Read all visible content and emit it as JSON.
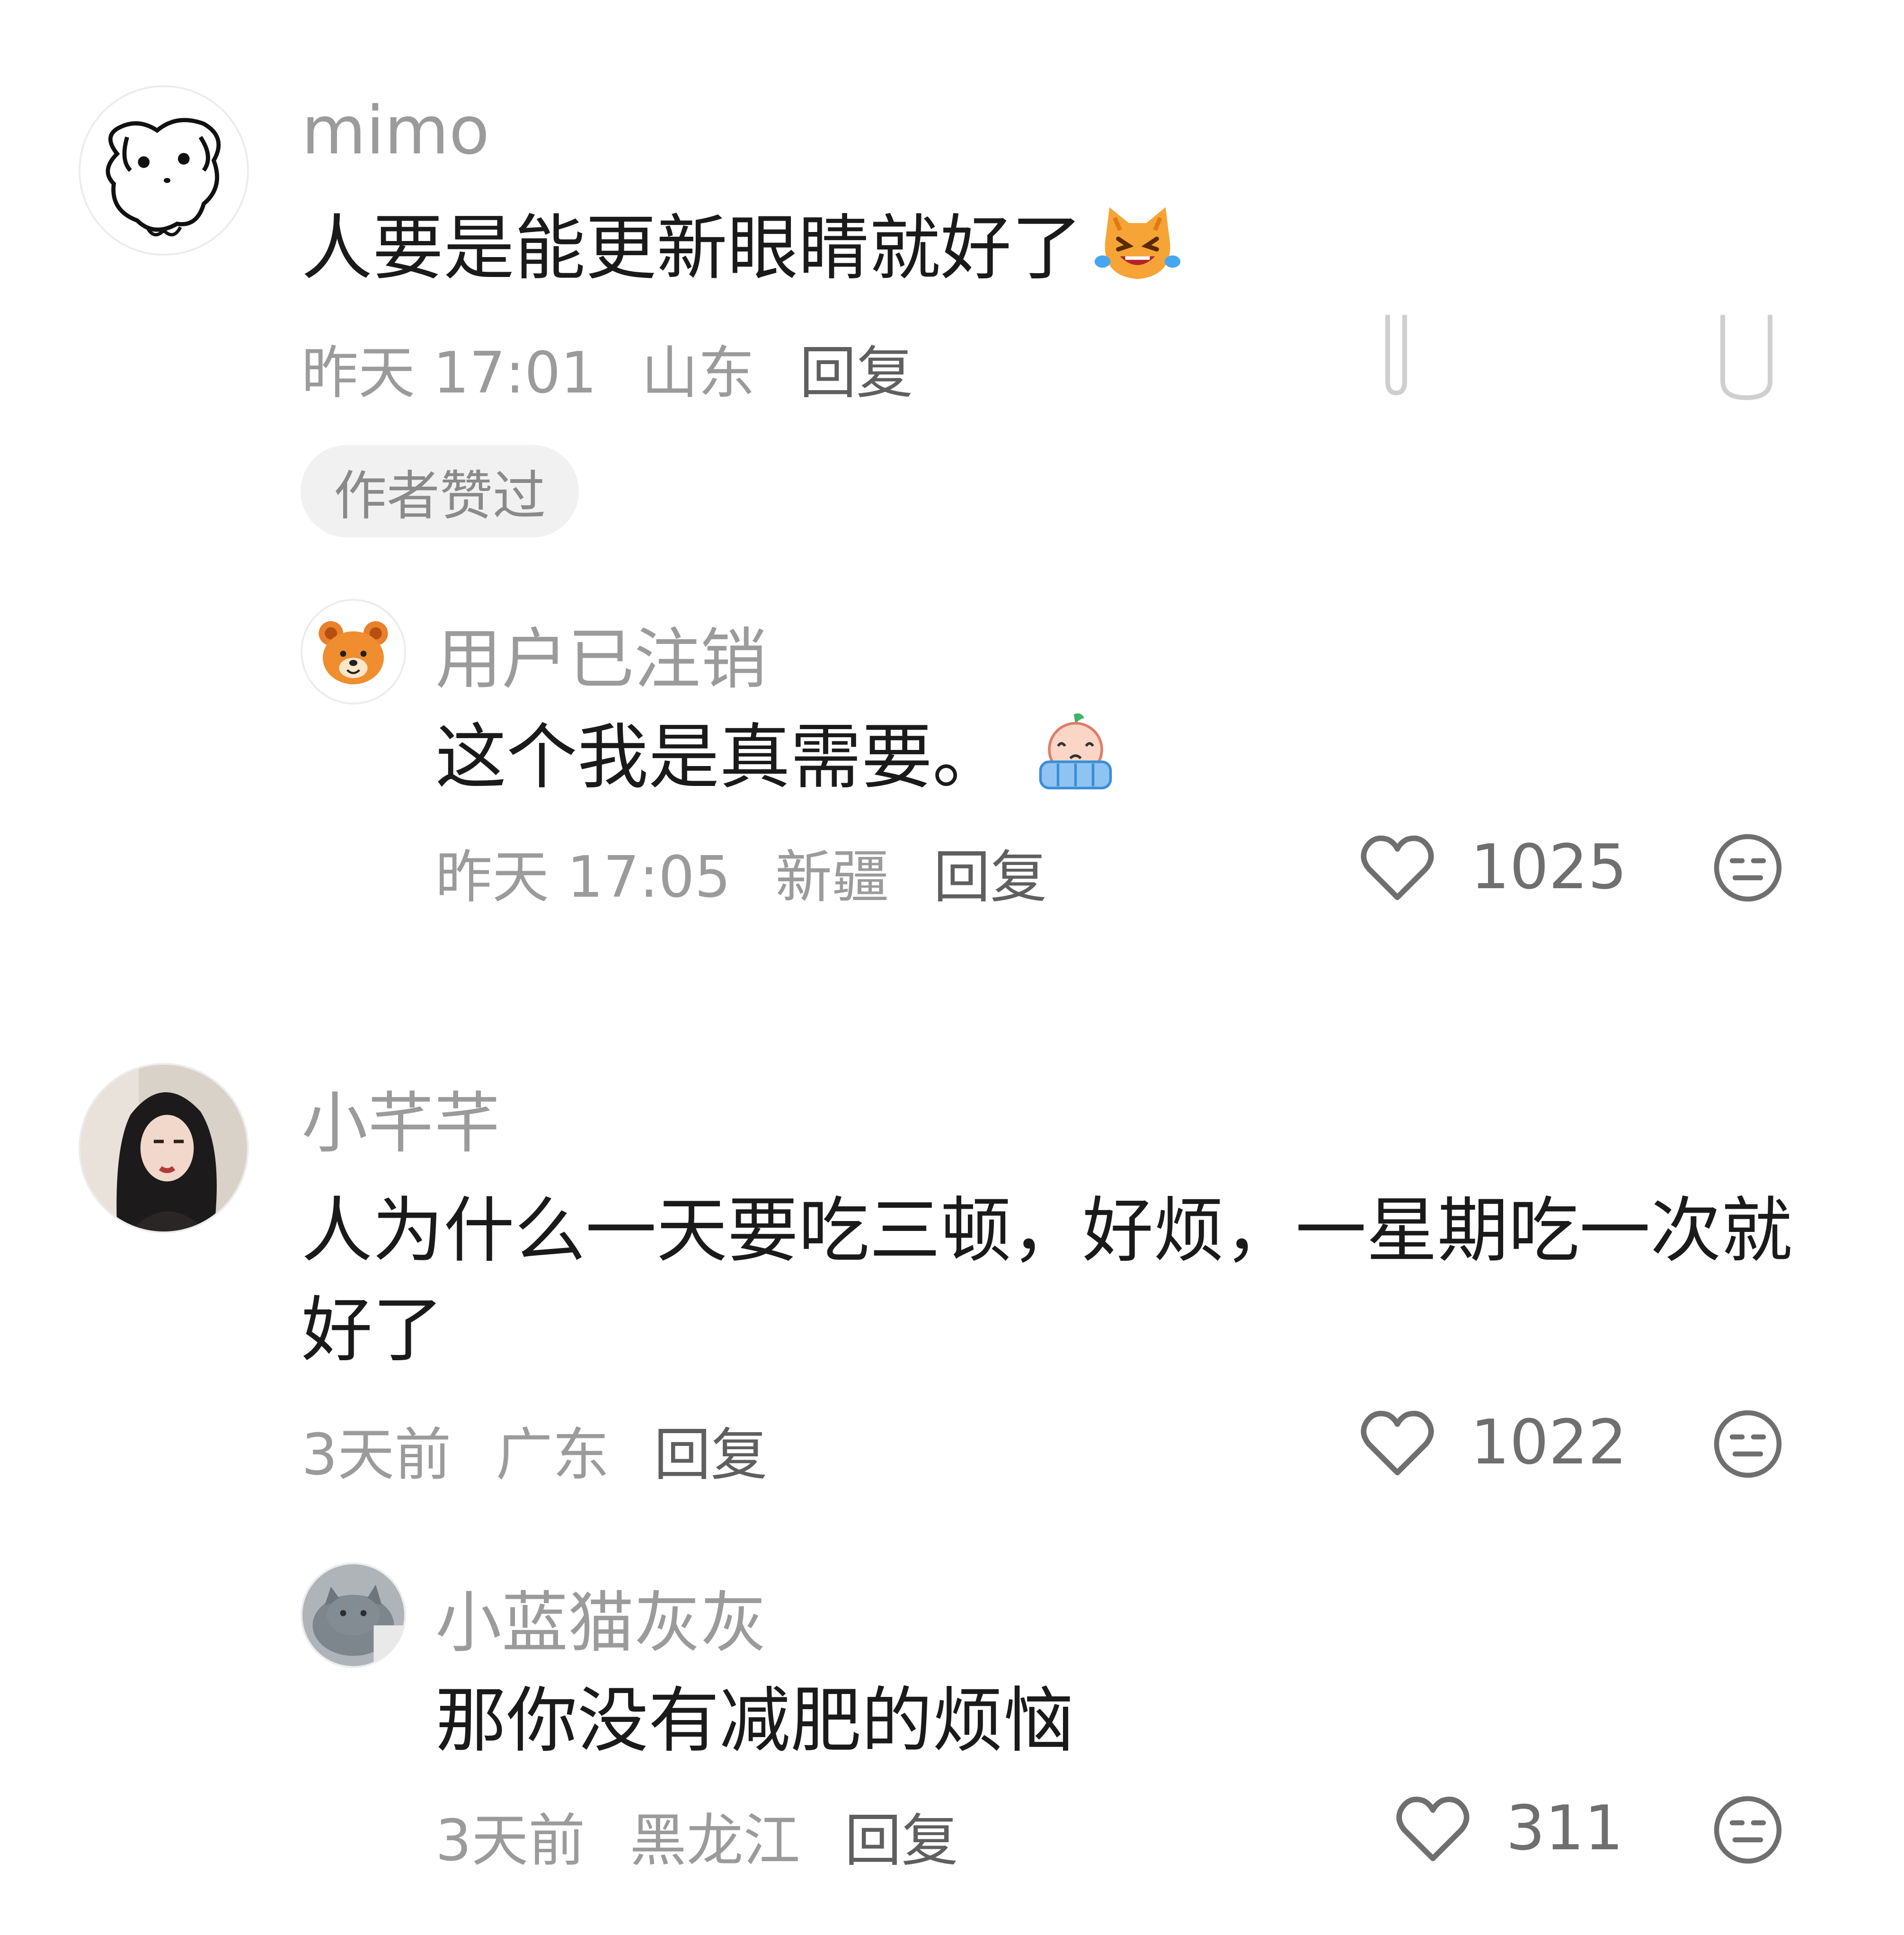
{
  "comments": [
    {
      "username": "mimo",
      "text": "人要是能更新眼睛就好了",
      "emoji": "laughing-crying-cat-emoji",
      "time": "昨天 17:01",
      "location": "山东",
      "reply_label": "回复",
      "badge": "作者赞过",
      "reply": {
        "username": "用户已注销",
        "text": "这个我是真需要。",
        "emoji": "crying-bath-emoji",
        "time": "昨天 17:05",
        "location": "新疆",
        "reply_label": "回复",
        "likes": "1025"
      }
    },
    {
      "username": "小芊芊",
      "text": "人为什么一天要吃三顿，好烦，一星期吃一次就好了",
      "time": "3天前",
      "location": "广东",
      "reply_label": "回复",
      "likes": "1022",
      "reply": {
        "username": "小蓝猫灰灰",
        "text": "那你没有减肥的烦恼",
        "time": "3天前",
        "location": "黑龙江",
        "reply_label": "回复",
        "likes": "311"
      }
    }
  ],
  "icons": {
    "like": "heart-outline-icon",
    "dislike": "meh-face-icon"
  },
  "colors": {
    "username": "#9b9b9b",
    "body": "#1a1a1a",
    "meta": "#9b9b9b",
    "badge_bg": "#f1f1f1"
  }
}
